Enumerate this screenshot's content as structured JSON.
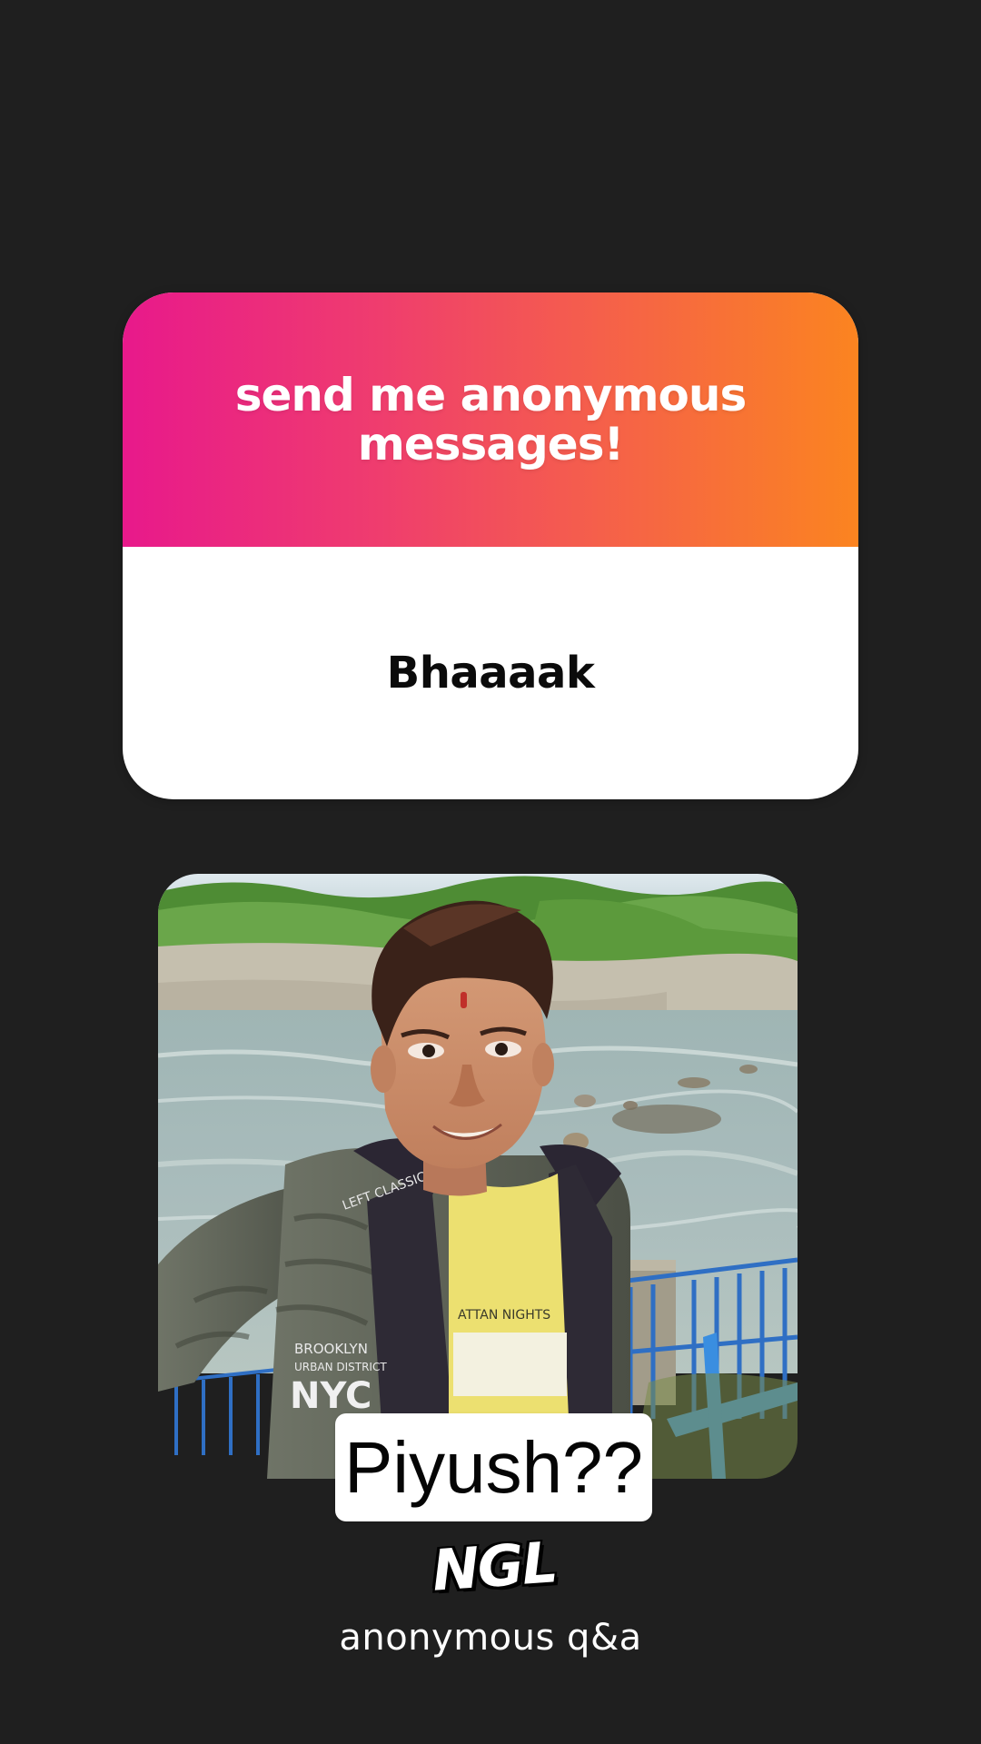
{
  "card": {
    "prompt": "send me anonymous messages!",
    "answer": "Bhaaaak",
    "gradient_colors": [
      "#e8198b",
      "#ef3d6e",
      "#f5604a",
      "#fb8420"
    ]
  },
  "photo": {
    "icon": "selfie-photo",
    "caption": "Piyush??"
  },
  "brand": {
    "logo_text": "NGL",
    "tagline": "anonymous q&a"
  },
  "colors": {
    "background": "#1f1f1f",
    "card_body": "#ffffff",
    "text_dark": "#0b0b0b"
  }
}
